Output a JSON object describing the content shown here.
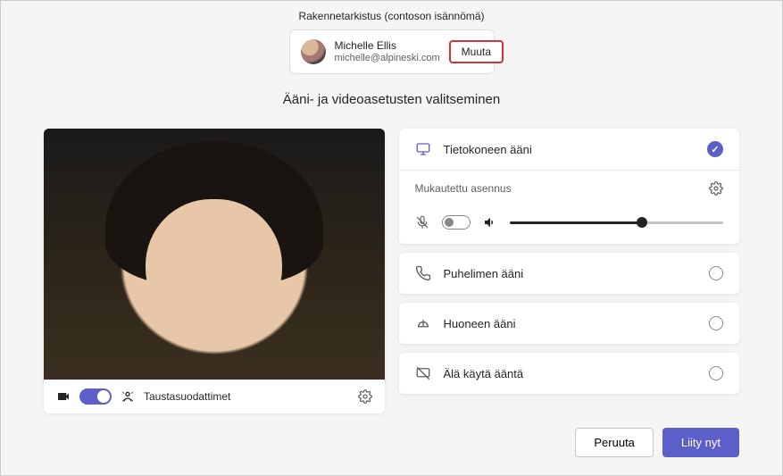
{
  "header": {
    "title": "Rakennetarkistus (contoson isännömä)"
  },
  "identity": {
    "name": "Michelle Ellis",
    "email": "michelle@alpineski.com",
    "change_label": "Muuta"
  },
  "subtitle": "Ääni- ja videoasetusten valitseminen",
  "video": {
    "camera_on": true,
    "filters_label": "Taustasuodattimet"
  },
  "audio": {
    "computer": {
      "label": "Tietokoneen ääni",
      "selected": true
    },
    "custom_setup_label": "Mukautettu asennus",
    "mic_on": false,
    "volume_percent": 62,
    "phone": {
      "label": "Puhelimen ääni",
      "selected": false
    },
    "room": {
      "label": "Huoneen ääni",
      "selected": false
    },
    "none": {
      "label": "Älä käytä ääntä",
      "selected": false
    }
  },
  "footer": {
    "cancel_label": "Peruuta",
    "join_label": "Liity nyt"
  },
  "colors": {
    "accent": "#5b5fc7",
    "danger_border": "#d13438"
  }
}
